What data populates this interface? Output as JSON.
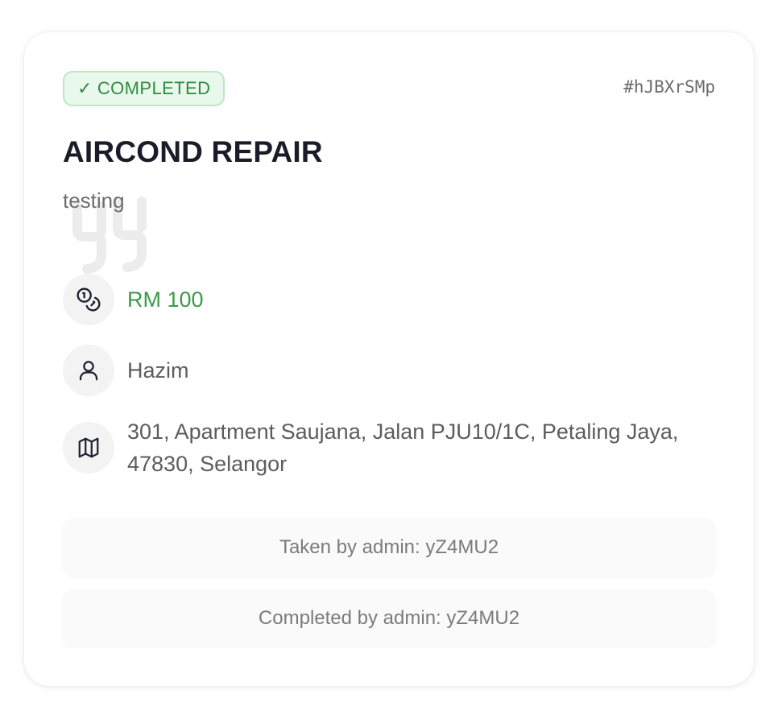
{
  "job": {
    "status_label": "COMPLETED",
    "status_check": "✓",
    "id": "#hJBXrSMp",
    "title": "AIRCOND REPAIR",
    "description": "testing",
    "price": "RM 100",
    "customer": "Hazim",
    "address": "301, Apartment Saujana, Jalan PJU10/1C, Petaling Jaya, 47830, Selangor",
    "taken_by": "Taken by admin: yZ4MU2",
    "completed_by": "Completed by admin: yZ4MU2"
  },
  "icons": {
    "status": "check-icon",
    "description": "quote-icon",
    "price": "coins-icon",
    "customer": "user-icon",
    "address": "map-icon"
  },
  "colors": {
    "status_text": "#2f8b3e",
    "status_bg": "#e9f8ec",
    "status_border": "#b9e9c4",
    "price": "#3a9b49",
    "title": "#1a1d29"
  }
}
